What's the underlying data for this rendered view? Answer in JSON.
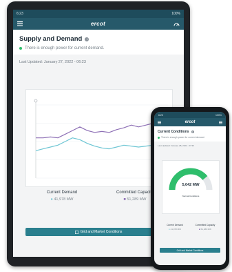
{
  "tablet": {
    "status_bar": {
      "time": "6:23",
      "battery": "100%"
    },
    "nav": {
      "logo": "ercot"
    },
    "card": {
      "title": "Supply and Demand",
      "status": "There is enough power for current demand."
    },
    "last_updated": "Last Updated: January 27, 2022 - 06:23",
    "legend": {
      "current_demand": {
        "label": "Current Demand",
        "value": "41,978 MW"
      },
      "committed_capacity": {
        "label": "Committed Capacity",
        "value": "51,289 MW"
      }
    },
    "button_label": "Grid and Market Conditions"
  },
  "phone": {
    "status_bar": {
      "time": "6:23",
      "battery": "100%"
    },
    "nav": {
      "logo": "ercot"
    },
    "card": {
      "title": "Current Conditions",
      "status": "There is enough power for current demand."
    },
    "last_updated": "Last Updated: January 28, 2022 - 07:30",
    "gauge": {
      "value": "5,042 MW",
      "label": "Normal Conditions",
      "level": 0.78
    },
    "legend": {
      "current_demand": {
        "label": "Current Demand",
        "value": "41,978 MW"
      },
      "committed_capacity": {
        "label": "Committed Capacity",
        "value": "51,289 MW"
      }
    },
    "button_label": "Grid and Market Conditions"
  },
  "colors": {
    "header": "#26596a",
    "status_bar": "#1e4c5c",
    "button": "#2a7f8e",
    "demand_line": "#6ec6d4",
    "capacity_line": "#8d6fb5",
    "gauge_fill": "#2fbe6c",
    "ok_dot": "#2fbe6c"
  },
  "icons": [
    "menu-icon",
    "ercot-logo-icon",
    "gauge-icon",
    "info-icon",
    "grid-icon"
  ],
  "chart_data": {
    "type": "line",
    "series": [
      {
        "values": [
          44,
          44,
          45,
          44,
          48,
          52,
          56,
          52,
          50,
          51,
          50,
          53,
          55,
          58,
          56,
          58,
          60,
          58,
          60
        ]
      },
      {
        "values": [
          30,
          32,
          34,
          36,
          40,
          44,
          42,
          38,
          35,
          33,
          32,
          34,
          36,
          35,
          34,
          35,
          36,
          37,
          38
        ]
      }
    ],
    "ylim": [
      0,
      80
    ],
    "grid": true
  }
}
